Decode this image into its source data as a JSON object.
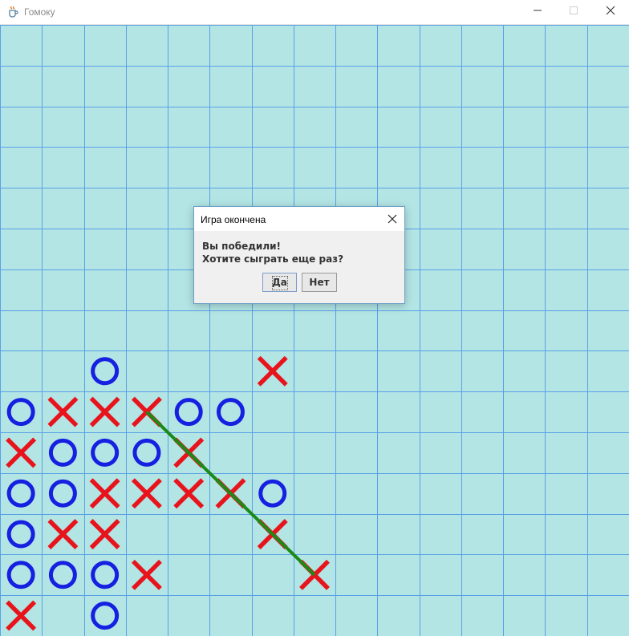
{
  "window": {
    "title": "Гомоку",
    "icon": "java-cup-icon",
    "controls": [
      "minimize-icon",
      "maximize-icon",
      "close-icon"
    ]
  },
  "board": {
    "rows": 15,
    "cols": 15,
    "colors": {
      "background": "#b3e5e5",
      "grid": "#5aa0e6",
      "x": "#e8141c",
      "o": "#1520e0",
      "win_line": "#1c8a17"
    },
    "cells_x": [
      [
        8,
        6
      ],
      [
        9,
        1
      ],
      [
        9,
        2
      ],
      [
        9,
        3
      ],
      [
        10,
        0
      ],
      [
        10,
        4
      ],
      [
        11,
        2
      ],
      [
        11,
        3
      ],
      [
        11,
        4
      ],
      [
        11,
        5
      ],
      [
        12,
        1
      ],
      [
        12,
        2
      ],
      [
        12,
        6
      ],
      [
        13,
        3
      ],
      [
        13,
        7
      ],
      [
        14,
        0
      ]
    ],
    "cells_o": [
      [
        8,
        2
      ],
      [
        9,
        0
      ],
      [
        9,
        4
      ],
      [
        9,
        5
      ],
      [
        10,
        1
      ],
      [
        10,
        2
      ],
      [
        10,
        3
      ],
      [
        11,
        0
      ],
      [
        11,
        1
      ],
      [
        11,
        6
      ],
      [
        12,
        0
      ],
      [
        13,
        0
      ],
      [
        13,
        1
      ],
      [
        13,
        2
      ],
      [
        14,
        2
      ]
    ],
    "win_line": {
      "from": [
        9,
        3
      ],
      "to": [
        13,
        7
      ]
    }
  },
  "dialog": {
    "title": "Игра окончена",
    "message_line1": "Вы победили!",
    "message_line2": "Хотите сыграть еще раз?",
    "yes_label": "Да",
    "no_label": "Нет"
  }
}
